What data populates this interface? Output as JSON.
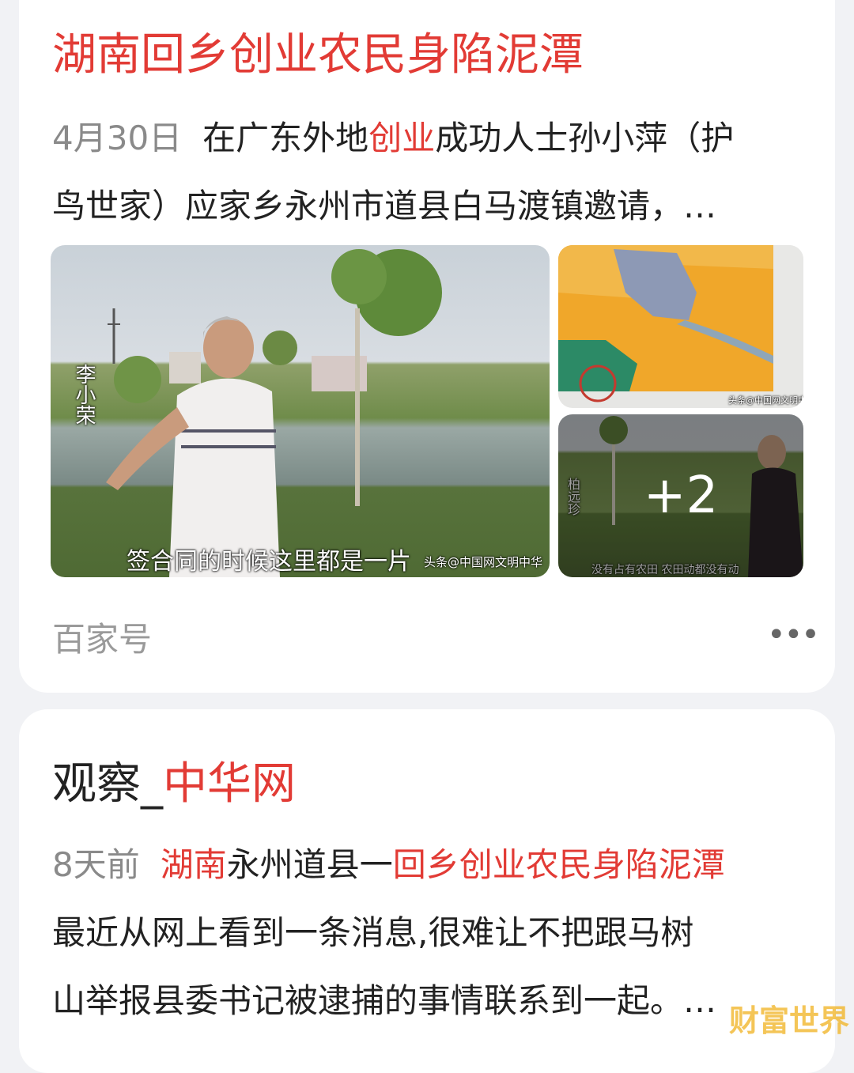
{
  "result1": {
    "title": "湖南回乡创业农民身陷泥潭",
    "date": "4月30日",
    "snippet_line1_a": "在广东外地",
    "snippet_line1_hl": "创业",
    "snippet_line1_b": "成功人士孙小萍（护",
    "snippet_line2": "鸟世家）应家乡永州市道县白马渡镇邀请，…",
    "images": {
      "main_name": "李小荣",
      "main_subtitle": "签合同的时候这里都是一片",
      "main_credit": "头条@中国网文明中华",
      "map_credit": "头条@中国网文明中华",
      "field_name": "柏远珍",
      "field_subtitle": "没有占有农田 农田动都没有动",
      "more_count": "+2"
    },
    "source": "百家号",
    "more_icon": "more-dots-icon"
  },
  "result2": {
    "title_a": "观察_",
    "title_hl": "中华网",
    "date": "8天前",
    "snippet_line1_hl1": "湖南",
    "snippet_line1_a": "永州道县一",
    "snippet_line1_hl2": "回乡创业农民身陷泥潭",
    "snippet_line2": "最近从网上看到一条消息,很难让不把跟马树",
    "snippet_line3": "山举报县委书记被逮捕的事情联系到一起。…"
  },
  "watermark": "财富世界",
  "colors": {
    "highlight": "#e23b35",
    "meta_gray": "#8a8a8a",
    "card_bg": "#ffffff",
    "page_bg": "#f1f2f5"
  }
}
